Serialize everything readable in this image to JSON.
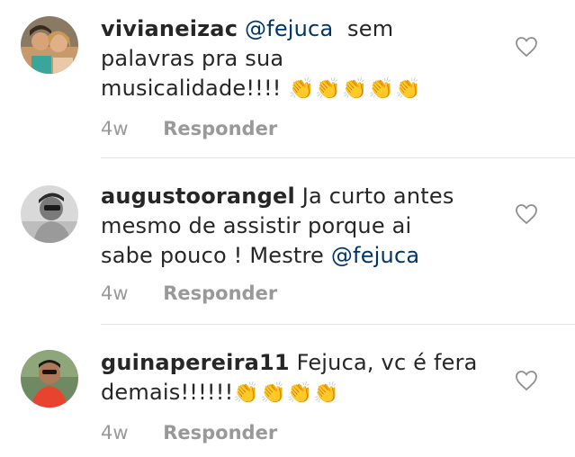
{
  "comments": [
    {
      "username": "vivianeizac",
      "mention": "@fejuca",
      "text_line1_after": "  sem",
      "text_line2": "palavras pra sua",
      "text_line3": "musicalidade!!!! ",
      "emoji": "👏👏👏👏👏",
      "time": "4w",
      "reply_label": "Responder"
    },
    {
      "username": "augustoorangel",
      "text_line1_after": " Ja curto antes",
      "text_line2": "mesmo de assistir porque ai",
      "text_line3": "sabe pouco ! Mestre ",
      "mention": "@fejuca",
      "time": "4w",
      "reply_label": "Responder"
    },
    {
      "username": "guinapereira11",
      "text_line1_after": " Fejuca, vc é fera",
      "text_line2": "demais!!!!!!",
      "emoji": "👏👏👏👏",
      "time": "4w",
      "reply_label": "Responder"
    }
  ],
  "colors": {
    "text": "#262626",
    "mention": "#003569",
    "meta": "#999999",
    "divider": "#e3e3e3"
  },
  "icons": {
    "like": "heart-outline-icon"
  }
}
